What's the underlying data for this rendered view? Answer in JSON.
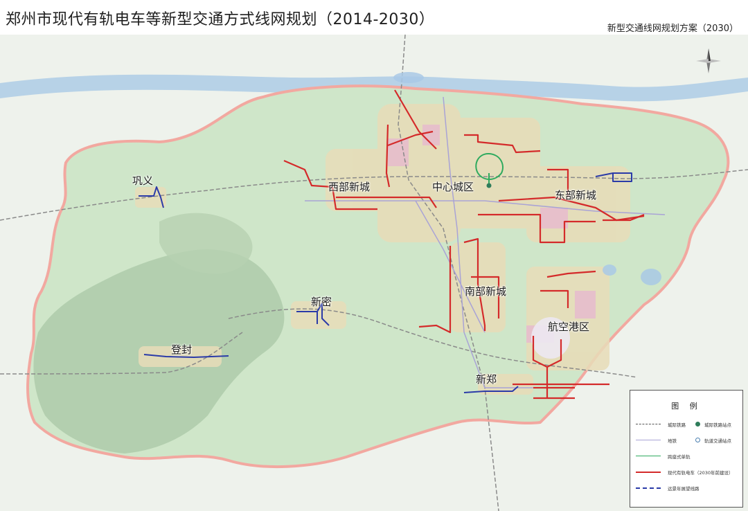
{
  "header": {
    "title": "郑州市现代有轨电车等新型交通方式线网规划（2014-2030）",
    "subtitle": "新型交通线网规划方案（2030）"
  },
  "places": {
    "gongyi": "巩义",
    "xibu": "西部新城",
    "zhongxin": "中心城区",
    "dongbu": "东部新城",
    "nanbu": "南部新城",
    "xinmi": "新密",
    "hangkong": "航空港区",
    "dengfeng": "登封",
    "xinzheng": "新郑"
  },
  "legend": {
    "title": "图 例",
    "items": [
      {
        "label": "城际铁路",
        "type": "dashed",
        "color": "#555555"
      },
      {
        "label": "城际铁路站点",
        "type": "dot",
        "color": "#2e7d5b"
      },
      {
        "label": "地铁",
        "type": "solid",
        "color": "#a9a3d6"
      },
      {
        "label": "轨道交通站点",
        "type": "ring",
        "color": "#4a7fb0"
      },
      {
        "label": "跨座式单轨",
        "type": "solid",
        "color": "#2eaa5e"
      },
      {
        "label": "现代有轨电车（2030年前建设）",
        "type": "solid",
        "color": "#d42a2a"
      },
      {
        "label": "远景年展望线路",
        "type": "dashed",
        "color": "#2a3aa8"
      }
    ]
  },
  "colors": {
    "tram": "#d42a2a",
    "future": "#2a3aa8",
    "monorail": "#2eaa5e",
    "boundary": "#f2a8a0",
    "land": "#cfe6c9",
    "mountain": "#a9c7a6",
    "river": "#a9c9e6"
  }
}
